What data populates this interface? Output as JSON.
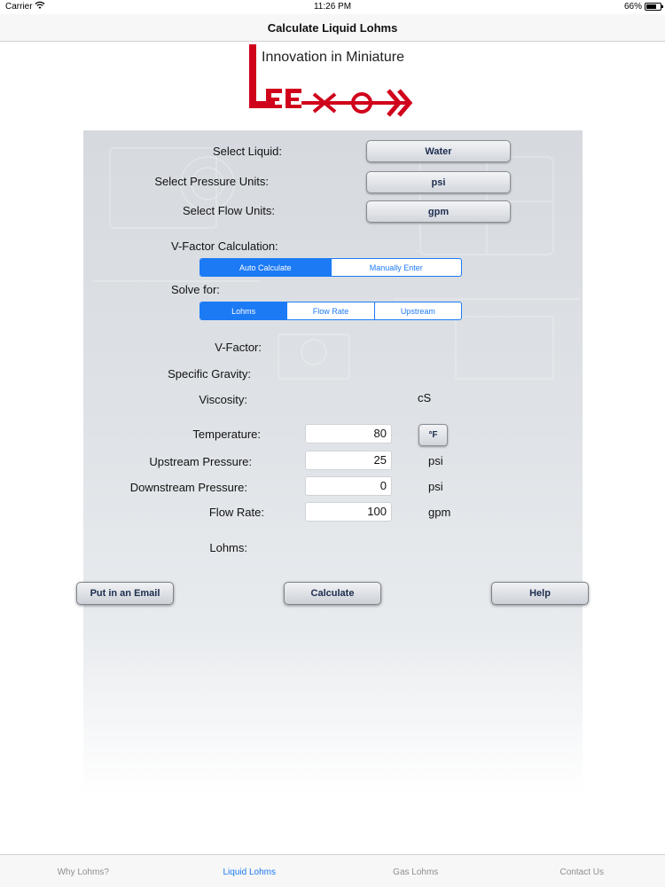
{
  "status_bar": {
    "carrier": "Carrier",
    "time": "11:26 PM",
    "battery": "66%"
  },
  "nav": {
    "title": "Calculate Liquid Lohms"
  },
  "logo": {
    "tagline": "Innovation in Miniature",
    "brand_text": "LEE",
    "color": "#d0021b"
  },
  "form": {
    "select_liquid": {
      "label": "Select Liquid:",
      "value": "Water"
    },
    "select_pressure_units": {
      "label": "Select Pressure Units:",
      "value": "psi"
    },
    "select_flow_units": {
      "label": "Select Flow Units:",
      "value": "gpm"
    },
    "vfactor_calc": {
      "label": "V-Factor Calculation:",
      "options": [
        "Auto Calculate",
        "Manually Enter"
      ],
      "selected": "Auto Calculate"
    },
    "solve_for": {
      "label": "Solve for:",
      "options": [
        "Lohms",
        "Flow Rate",
        "Upstream"
      ],
      "selected": "Lohms"
    },
    "v_factor": {
      "label": "V-Factor:"
    },
    "specific_gravity": {
      "label": "Specific Gravity:"
    },
    "viscosity": {
      "label": "Viscosity:",
      "unit": "cS"
    },
    "temperature": {
      "label": "Temperature:",
      "value": "80",
      "unit_button": "°F"
    },
    "upstream_pressure": {
      "label": "Upstream Pressure:",
      "value": "25",
      "unit": "psi"
    },
    "downstream_pressure": {
      "label": "Downstream Pressure:",
      "value": "0",
      "unit": "psi"
    },
    "flow_rate": {
      "label": "Flow Rate:",
      "value": "100",
      "unit": "gpm"
    },
    "lohms": {
      "label": "Lohms:"
    }
  },
  "actions": {
    "email": "Put in an Email",
    "calculate": "Calculate",
    "help": "Help"
  },
  "tabs": [
    {
      "label": "Why Lohms?",
      "active": false
    },
    {
      "label": "Liquid Lohms",
      "active": true
    },
    {
      "label": "Gas Lohms",
      "active": false
    },
    {
      "label": "Contact Us",
      "active": false
    }
  ],
  "colors": {
    "accent": "#1c7af5",
    "button_text": "#1c2d4f"
  }
}
